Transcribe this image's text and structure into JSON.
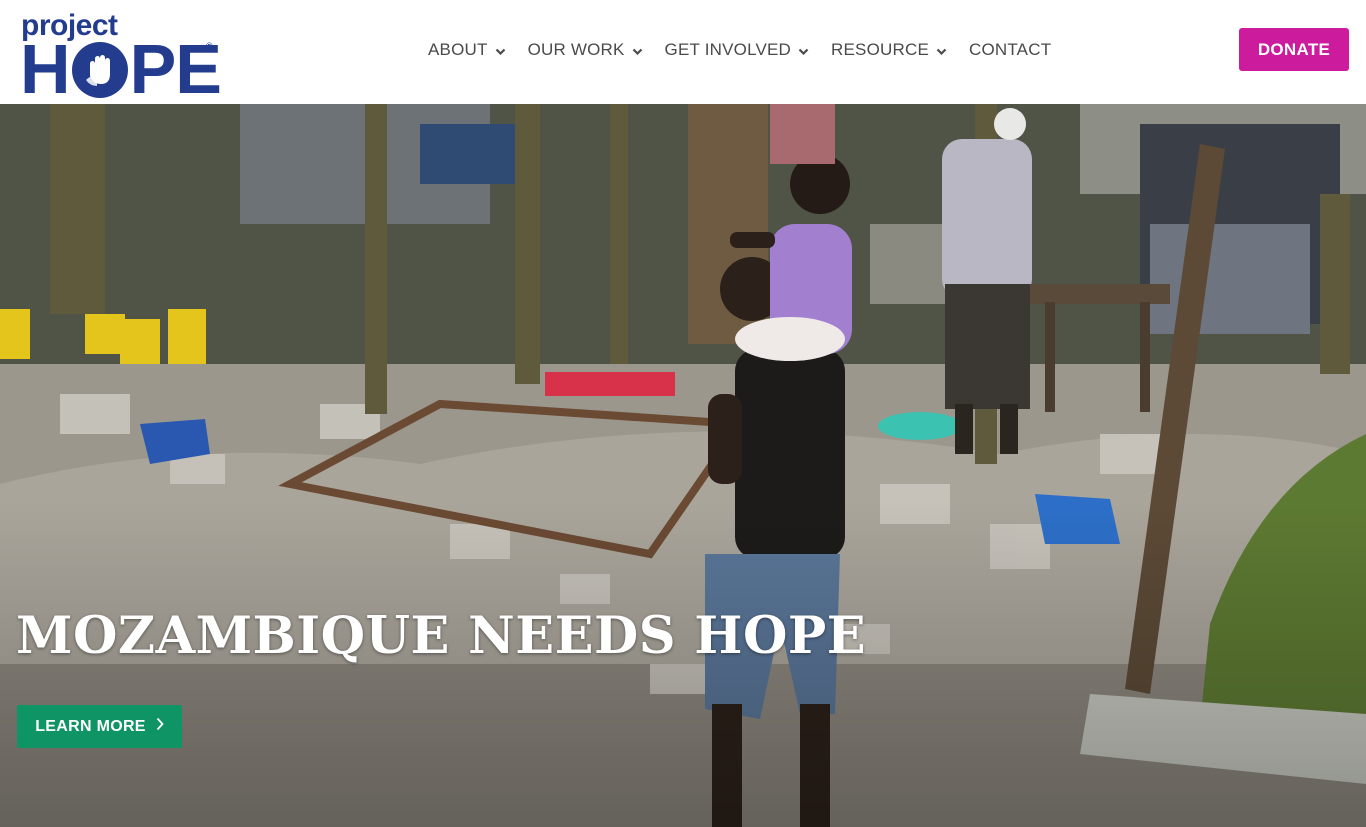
{
  "brand": {
    "logo_top": "project",
    "logo_h": "H",
    "logo_pe": "PE",
    "logo_reg": "®"
  },
  "nav": {
    "items": [
      {
        "label": "ABOUT",
        "has_dropdown": true
      },
      {
        "label": "OUR WORK",
        "has_dropdown": true
      },
      {
        "label": "GET INVOLVED",
        "has_dropdown": true
      },
      {
        "label": "RESOURCE",
        "has_dropdown": true
      },
      {
        "label": "CONTACT",
        "has_dropdown": false
      }
    ],
    "donate_label": "DONATE"
  },
  "hero": {
    "title": "MOZAMBIQUE NEEDS HOPE",
    "cta_label": "LEARN MORE",
    "cta_icon": "chevron-right-icon"
  },
  "colors": {
    "brand_blue": "#233c8e",
    "donate_magenta": "#cc1b9c",
    "cta_green": "#0f9466",
    "nav_text": "#4a4a4a"
  }
}
